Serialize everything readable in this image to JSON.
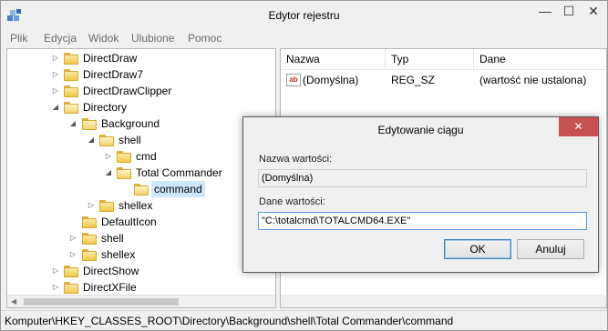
{
  "window": {
    "title": "Edytor rejestru",
    "minimize_glyph": "—",
    "maximize_glyph": "☐",
    "close_glyph": "✕"
  },
  "menu": [
    "Plik",
    "Edycja",
    "Widok",
    "Ulubione",
    "Pomoc"
  ],
  "tree": {
    "nodes": [
      {
        "label": "DirectDraw",
        "expander": "▷"
      },
      {
        "label": "DirectDraw7",
        "expander": "▷"
      },
      {
        "label": "DirectDrawClipper",
        "expander": "▷"
      },
      {
        "label": "Directory",
        "expander": "◢"
      },
      {
        "label": "Background",
        "expander": "◢"
      },
      {
        "label": "shell",
        "expander": "◢"
      },
      {
        "label": "cmd",
        "expander": "▷"
      },
      {
        "label": "Total Commander",
        "expander": "◢"
      },
      {
        "label": "command",
        "expander": ""
      },
      {
        "label": "shellex",
        "expander": "▷"
      },
      {
        "label": "DefaultIcon",
        "expander": ""
      },
      {
        "label": "shell",
        "expander": "▷"
      },
      {
        "label": "shellex",
        "expander": "▷"
      },
      {
        "label": "DirectShow",
        "expander": "▷"
      },
      {
        "label": "DirectXFile",
        "expander": "▷"
      }
    ]
  },
  "values": {
    "columns": [
      "Nazwa",
      "Typ",
      "Dane"
    ],
    "icon_text": "ab",
    "rows": [
      {
        "name": "(Domyślna)",
        "type": "REG_SZ",
        "data": "(wartość nie ustalona)"
      }
    ]
  },
  "status": {
    "path": "Komputer\\HKEY_CLASSES_ROOT\\Directory\\Background\\shell\\Total Commander\\command"
  },
  "dialog": {
    "title": "Edytowanie ciągu",
    "close_glyph": "✕",
    "value_name_label": "Nazwa wartości:",
    "value_name": "(Domyślna)",
    "value_data_label": "Dane wartości:",
    "value_data": "\"C:\\totalcmd\\TOTALCMD64.EXE\"",
    "ok_label": "OK",
    "cancel_label": "Anuluj"
  },
  "colors": {
    "selection": "#cce8ff",
    "close_button": "#c75050",
    "focus_border": "#569de5"
  }
}
